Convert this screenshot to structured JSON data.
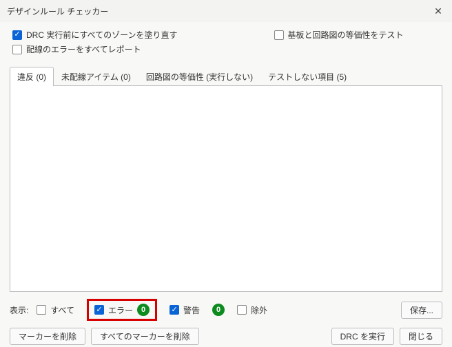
{
  "title": "デザインルール チェッカー",
  "options": {
    "refill_zones": "DRC 実行前にすべてのゾーンを塗り直す",
    "test_parity": "基板と回路図の等価性をテスト",
    "report_all_track": "配線のエラーをすべてレポート"
  },
  "tabs": {
    "violations": "違反 (0)",
    "unrouted": "未配線アイテム (0)",
    "parity": "回路図の等価性 (実行しない)",
    "excluded": "テストしない項目 (5)"
  },
  "filters": {
    "show_label": "表示:",
    "all": "すべて",
    "errors": "エラー",
    "errors_count": "0",
    "warnings": "警告",
    "warnings_count": "0",
    "exclusions": "除外"
  },
  "buttons": {
    "save": "保存...",
    "delete_marker": "マーカーを削除",
    "delete_all_markers": "すべてのマーカーを削除",
    "run_drc": "DRC を実行",
    "close": "閉じる"
  }
}
